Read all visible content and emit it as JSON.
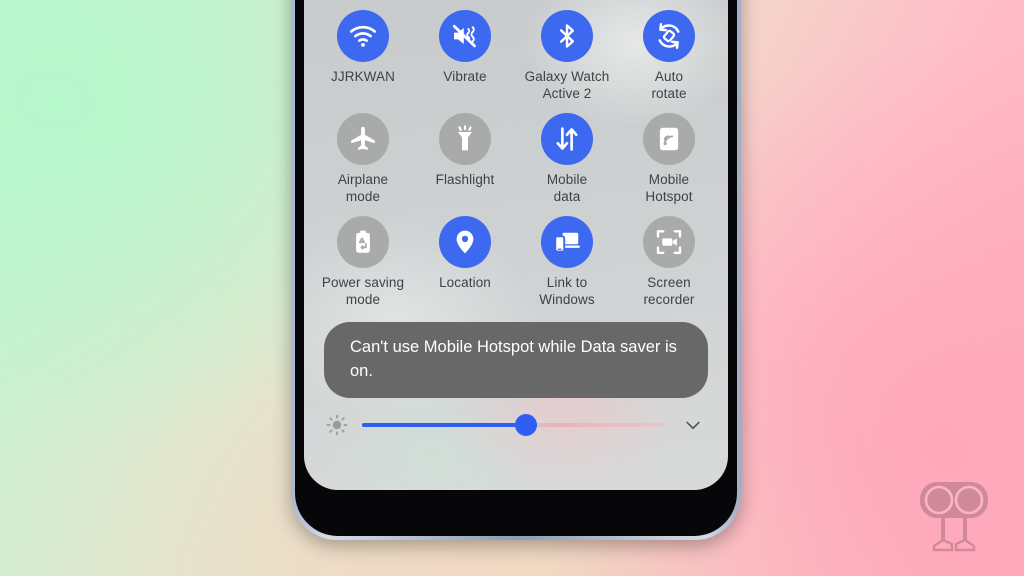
{
  "background": {
    "gradient_from": "#bdf6d0",
    "gradient_mid": "#f0dcc9",
    "gradient_to": "#ffaabd"
  },
  "device": {
    "frame_color": "#a9b6cc",
    "bezel_color": "#070709",
    "screen_bg": "#cfd2d3"
  },
  "quick_settings": {
    "accent_on": "#3d68f0",
    "accent_off": "#a9abab",
    "label_color": "#3f4144",
    "tiles": [
      {
        "id": "wifi",
        "icon": "wifi-icon",
        "label": "JJRKWAN",
        "state": "on"
      },
      {
        "id": "vibrate",
        "icon": "vibrate-icon",
        "label": "Vibrate",
        "state": "on"
      },
      {
        "id": "bluetooth",
        "icon": "bluetooth-icon",
        "label": "Galaxy Watch\nActive 2",
        "state": "on"
      },
      {
        "id": "auto-rotate",
        "icon": "auto-rotate-icon",
        "label": "Auto\nrotate",
        "state": "on"
      },
      {
        "id": "airplane-mode",
        "icon": "airplane-icon",
        "label": "Airplane\nmode",
        "state": "off"
      },
      {
        "id": "flashlight",
        "icon": "flashlight-icon",
        "label": "Flashlight",
        "state": "off"
      },
      {
        "id": "mobile-data",
        "icon": "mobile-data-icon",
        "label": "Mobile\ndata",
        "state": "on"
      },
      {
        "id": "mobile-hotspot",
        "icon": "mobile-hotspot-icon",
        "label": "Mobile\nHotspot",
        "state": "off"
      },
      {
        "id": "power-saving",
        "icon": "power-saving-icon",
        "label": "Power saving\nmode",
        "state": "off"
      },
      {
        "id": "location",
        "icon": "location-pin-icon",
        "label": "Location",
        "state": "on"
      },
      {
        "id": "link-to-windows",
        "icon": "link-to-windows-icon",
        "label": "Link to\nWindows",
        "state": "on"
      },
      {
        "id": "screen-recorder",
        "icon": "screen-recorder-icon",
        "label": "Screen\nrecorder",
        "state": "off"
      }
    ]
  },
  "toast": {
    "message": "Can't use Mobile Hotspot while Data saver is on.",
    "background": "#686868",
    "text_color": "#ffffff"
  },
  "brightness": {
    "icon": "brightness-sun-icon",
    "value_percent": 54,
    "fill_color": "#2f5ef0",
    "expand_icon": "chevron-down-icon"
  },
  "watermark": {
    "name": "site-watermark-logo",
    "color": "#8a5a66"
  }
}
